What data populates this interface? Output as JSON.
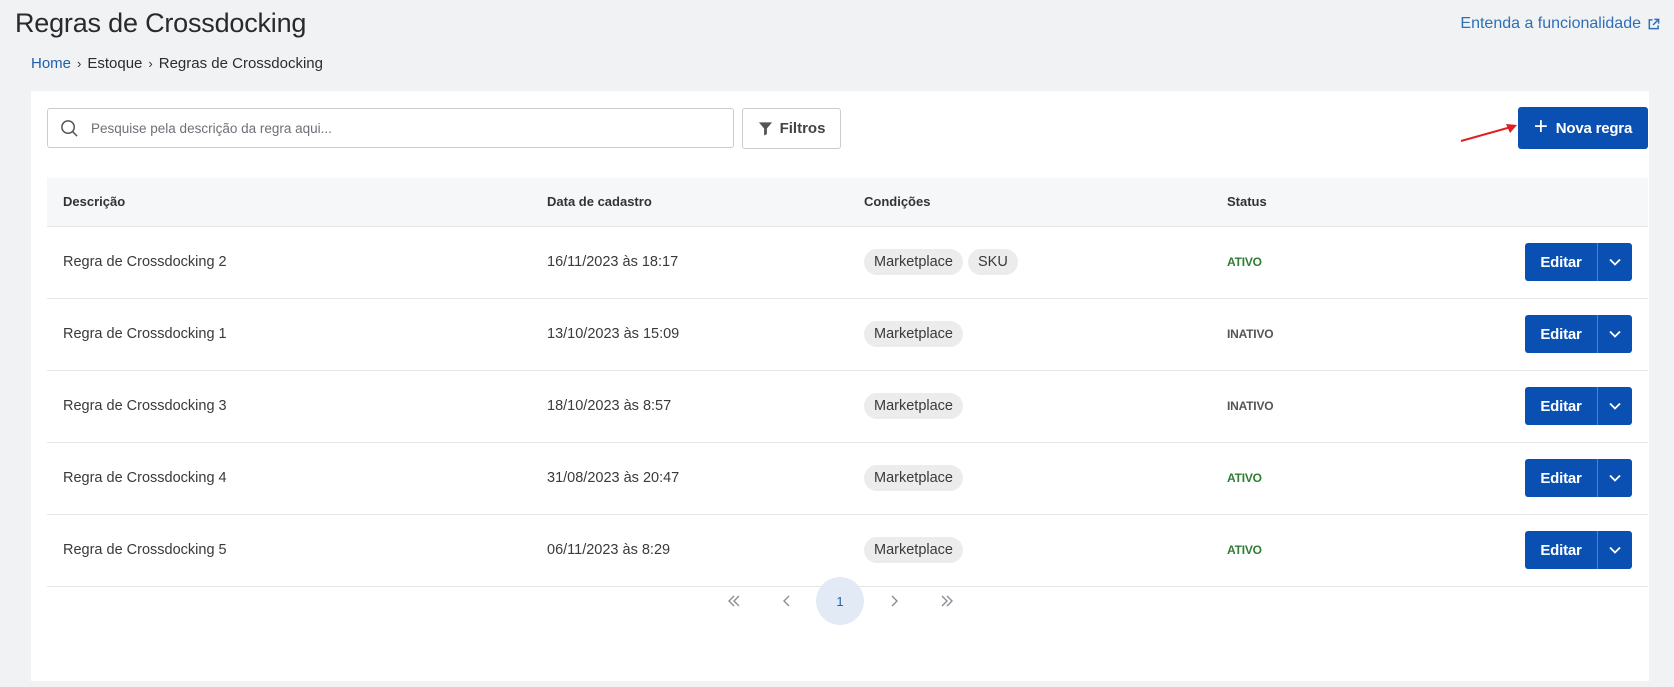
{
  "page": {
    "title": "Regras de Crossdocking",
    "help_link": "Entenda a funcionalidade"
  },
  "breadcrumb": [
    "Home",
    "Estoque",
    "Regras de Crossdocking"
  ],
  "toolbar": {
    "search_placeholder": "Pesquise pela descrição da regra aqui...",
    "filter_label": "Filtros",
    "new_label": "Nova regra"
  },
  "table": {
    "headers": [
      "Descrição",
      "Data de cadastro",
      "Condições",
      "Status"
    ],
    "rows": [
      {
        "descricao": "Regra de Crossdocking 2",
        "data": "16/11/2023 às 18:17",
        "condicoes": [
          "Marketplace",
          "SKU"
        ],
        "status": "ATIVO"
      },
      {
        "descricao": "Regra de Crossdocking 1",
        "data": "13/10/2023 às 15:09",
        "condicoes": [
          "Marketplace"
        ],
        "status": "INATIVO"
      },
      {
        "descricao": "Regra de Crossdocking 3",
        "data": "18/10/2023 às 8:57",
        "condicoes": [
          "Marketplace"
        ],
        "status": "INATIVO"
      },
      {
        "descricao": "Regra de Crossdocking 4",
        "data": "31/08/2023 às 20:47",
        "condicoes": [
          "Marketplace"
        ],
        "status": "ATIVO"
      },
      {
        "descricao": "Regra de Crossdocking 5",
        "data": "06/11/2023 às 8:29",
        "condicoes": [
          "Marketplace"
        ],
        "status": "ATIVO"
      }
    ],
    "edit_label": "Editar"
  },
  "pagination": {
    "current_page": "1"
  },
  "colors": {
    "primary": "#0a50b3",
    "link": "#1f5fad",
    "active": "#2e7d32",
    "annotation_arrow": "#e02020"
  }
}
